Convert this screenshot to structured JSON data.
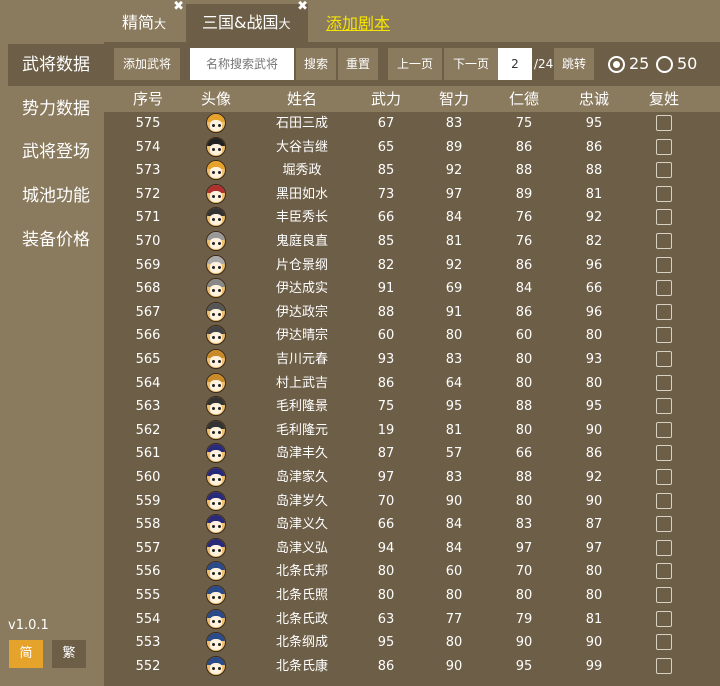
{
  "tabs": [
    {
      "label": "精简",
      "suffix": "大",
      "close": "✖"
    },
    {
      "label": "三国&战国",
      "suffix": "大",
      "close": "✖"
    }
  ],
  "add_script": "添加剧本",
  "sidebar": {
    "items": [
      {
        "label": "武将数据"
      },
      {
        "label": "势力数据"
      },
      {
        "label": "武将登场"
      },
      {
        "label": "城池功能"
      },
      {
        "label": "装备价格"
      }
    ],
    "version": "v1.0.1",
    "lang_simple": "简",
    "lang_trad": "繁"
  },
  "toolbar": {
    "add_general": "添加武将",
    "search_placeholder": "名称搜索武将",
    "search": "搜索",
    "reset": "重置",
    "prev": "上一页",
    "next": "下一页",
    "page": "2",
    "total": "/24",
    "jump": "跳转",
    "size_25": "25",
    "size_50": "50"
  },
  "table": {
    "headers": {
      "id": "序号",
      "avatar": "头像",
      "name": "姓名",
      "wu": "武力",
      "zhi": "智力",
      "ren": "仁德",
      "zhong": "忠诚",
      "revive": "复姓"
    },
    "rows": [
      {
        "id": "575",
        "name": "石田三成",
        "wu": "67",
        "zhi": "83",
        "ren": "75",
        "zhong": "95",
        "hat": "#e6a32c"
      },
      {
        "id": "574",
        "name": "大谷吉继",
        "wu": "65",
        "zhi": "89",
        "ren": "86",
        "zhong": "86",
        "hat": "#222222"
      },
      {
        "id": "573",
        "name": "堀秀政",
        "wu": "85",
        "zhi": "92",
        "ren": "88",
        "zhong": "88",
        "hat": "#e6a32c"
      },
      {
        "id": "572",
        "name": "黑田如水",
        "wu": "73",
        "zhi": "97",
        "ren": "89",
        "zhong": "81",
        "hat": "#b03030"
      },
      {
        "id": "571",
        "name": "丰臣秀长",
        "wu": "66",
        "zhi": "84",
        "ren": "76",
        "zhong": "92",
        "hat": "#333333"
      },
      {
        "id": "570",
        "name": "鬼庭良直",
        "wu": "85",
        "zhi": "81",
        "ren": "76",
        "zhong": "82",
        "hat": "#999999"
      },
      {
        "id": "569",
        "name": "片仓景纲",
        "wu": "82",
        "zhi": "92",
        "ren": "86",
        "zhong": "96",
        "hat": "#aaaaaa"
      },
      {
        "id": "568",
        "name": "伊达成实",
        "wu": "91",
        "zhi": "69",
        "ren": "84",
        "zhong": "66",
        "hat": "#888888"
      },
      {
        "id": "567",
        "name": "伊达政宗",
        "wu": "88",
        "zhi": "91",
        "ren": "86",
        "zhong": "96",
        "hat": "#555555"
      },
      {
        "id": "566",
        "name": "伊达晴宗",
        "wu": "60",
        "zhi": "80",
        "ren": "60",
        "zhong": "80",
        "hat": "#444444"
      },
      {
        "id": "565",
        "name": "吉川元春",
        "wu": "93",
        "zhi": "83",
        "ren": "80",
        "zhong": "93",
        "hat": "#c88a2a"
      },
      {
        "id": "564",
        "name": "村上武吉",
        "wu": "86",
        "zhi": "64",
        "ren": "80",
        "zhong": "80",
        "hat": "#c88a2a"
      },
      {
        "id": "563",
        "name": "毛利隆景",
        "wu": "75",
        "zhi": "95",
        "ren": "88",
        "zhong": "95",
        "hat": "#333333"
      },
      {
        "id": "562",
        "name": "毛利隆元",
        "wu": "19",
        "zhi": "81",
        "ren": "80",
        "zhong": "90",
        "hat": "#333333"
      },
      {
        "id": "561",
        "name": "岛津丰久",
        "wu": "87",
        "zhi": "57",
        "ren": "66",
        "zhong": "86",
        "hat": "#2a2a7a"
      },
      {
        "id": "560",
        "name": "岛津家久",
        "wu": "97",
        "zhi": "83",
        "ren": "88",
        "zhong": "92",
        "hat": "#2a2a7a"
      },
      {
        "id": "559",
        "name": "岛津岁久",
        "wu": "70",
        "zhi": "90",
        "ren": "80",
        "zhong": "90",
        "hat": "#2a2a7a"
      },
      {
        "id": "558",
        "name": "岛津义久",
        "wu": "66",
        "zhi": "84",
        "ren": "83",
        "zhong": "87",
        "hat": "#2a2a7a"
      },
      {
        "id": "557",
        "name": "岛津义弘",
        "wu": "94",
        "zhi": "84",
        "ren": "97",
        "zhong": "97",
        "hat": "#2a2a7a"
      },
      {
        "id": "556",
        "name": "北条氏邦",
        "wu": "80",
        "zhi": "60",
        "ren": "70",
        "zhong": "80",
        "hat": "#2a4a8a"
      },
      {
        "id": "555",
        "name": "北条氏照",
        "wu": "80",
        "zhi": "80",
        "ren": "80",
        "zhong": "80",
        "hat": "#2a4a8a"
      },
      {
        "id": "554",
        "name": "北条氏政",
        "wu": "63",
        "zhi": "77",
        "ren": "79",
        "zhong": "81",
        "hat": "#2a4a8a"
      },
      {
        "id": "553",
        "name": "北条纲成",
        "wu": "95",
        "zhi": "80",
        "ren": "90",
        "zhong": "90",
        "hat": "#2a4a8a"
      },
      {
        "id": "552",
        "name": "北条氏康",
        "wu": "86",
        "zhi": "90",
        "ren": "95",
        "zhong": "99",
        "hat": "#2a4a8a"
      }
    ]
  }
}
